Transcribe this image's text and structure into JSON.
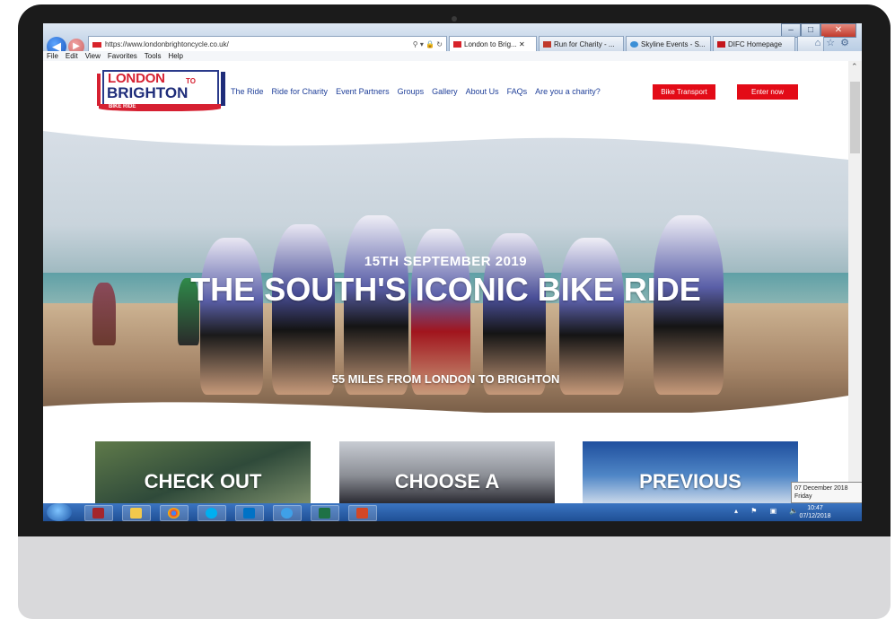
{
  "browser": {
    "url": "https://www.londonbrightoncycle.co.uk/",
    "tabs": [
      {
        "label": "London to Brig...",
        "icon": "london-brighton-favicon"
      },
      {
        "label": "Run for Charity - ...",
        "icon": "run-for-charity-favicon"
      },
      {
        "label": "Skyline Events - S...",
        "icon": "skyline-favicon"
      },
      {
        "label": "DIFC Homepage",
        "icon": "difc-favicon"
      }
    ],
    "menu": [
      "File",
      "Edit",
      "View",
      "Favorites",
      "Tools",
      "Help"
    ]
  },
  "site": {
    "logo": {
      "line1": "LONDON",
      "to": "TO",
      "line2": "BRIGHTON",
      "line3": "BIKE RIDE"
    },
    "nav": [
      "The Ride",
      "Ride for Charity",
      "Event Partners",
      "Groups",
      "Gallery",
      "About Us",
      "FAQs",
      "Are you a charity?"
    ],
    "btn_transport": "Bike Transport",
    "btn_enter": "Enter now",
    "hero": {
      "date": "15TH SEPTEMBER 2019",
      "title": "THE SOUTH'S ICONIC BIKE RIDE",
      "tagline": "55 MILES FROM LONDON TO BRIGHTON"
    },
    "cards": [
      "CHECK OUT",
      "CHOOSE A",
      "PREVIOUS"
    ]
  },
  "taskbar": {
    "time": "10:47",
    "date": "07/12/2018",
    "tooltip_line1": "07 December 2018",
    "tooltip_line2": "Friday"
  },
  "colors": {
    "brand_red": "#e30b17",
    "brand_blue": "#1f2d7a",
    "nav_blue": "#1f3f99"
  }
}
